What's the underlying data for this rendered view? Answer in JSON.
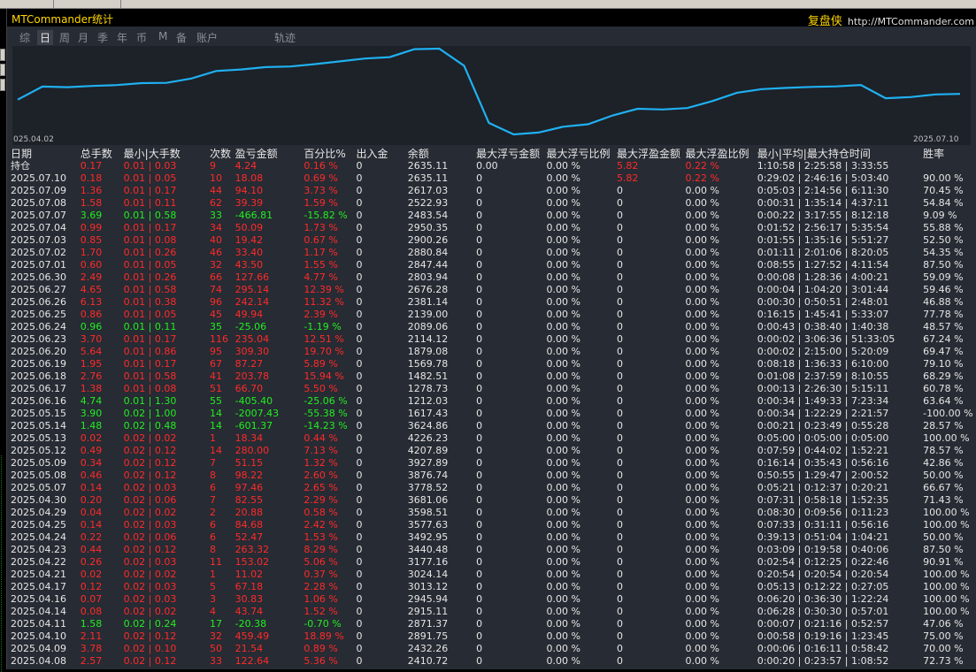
{
  "app": {
    "title": "MTCommander统计",
    "brand_name": "复盘侠",
    "brand_url": "http://MTCommander.com"
  },
  "tabs": [
    {
      "label": "综",
      "active": false
    },
    {
      "label": "日",
      "active": true
    },
    {
      "label": "周",
      "active": false
    },
    {
      "label": "月",
      "active": false
    },
    {
      "label": "季",
      "active": false
    },
    {
      "label": "年",
      "active": false
    },
    {
      "label": "币",
      "active": false
    },
    {
      "label": "M",
      "active": false
    },
    {
      "label": "备",
      "active": false
    },
    {
      "label": "账户",
      "active": false
    },
    {
      "label": "轨迹",
      "active": false
    }
  ],
  "chart_data": {
    "type": "line",
    "start_label": "025.04.02",
    "end_label": "2025.07.10",
    "line_color": "#1fb0f0",
    "series": [
      {
        "values": [
          2432.26,
          2891.75,
          2871.37,
          2915.11,
          2945.94,
          3013.12,
          3024.14,
          3177.16,
          3440.48,
          3492.95,
          3577.63,
          3598.51,
          3681.06,
          3778.52,
          3876.74,
          3927.89,
          4207.89,
          4226.23,
          3624.86,
          1617.43,
          1212.03,
          1278.73,
          1482.51,
          1569.78,
          1879.08,
          2114.12,
          2089.06,
          2139.0,
          2381.14,
          2676.28,
          2803.94,
          2847.44,
          2880.84,
          2900.26,
          2950.35,
          2483.54,
          2522.93,
          2617.03,
          2635.11
        ]
      }
    ]
  },
  "table": {
    "headers": [
      "日期",
      "总手数",
      "最小|大手数",
      "次数",
      "盈亏金额",
      "百分比%",
      "出入金",
      "余额",
      "最大浮亏金额",
      "最大浮亏比例",
      "最大浮盈金额",
      "最大浮盈比例",
      "最小|平均|最大持仓时间",
      "胜率"
    ],
    "rows": [
      {
        "d": "持仓",
        "lots": "0.17",
        "mm": "0.01 | 0.03",
        "cnt": "9",
        "pl": "4.24",
        "pct": "0.16 %",
        "dep": "0",
        "bal": "2635.11",
        "fl": "0.00",
        "flp": "0.00 %",
        "fp": "5.82",
        "fpp": "0.22 %",
        "time": "1:10:58 | 2:25:58 | 3:33:55",
        "win": "",
        "c": "r",
        "fr": true
      },
      {
        "d": "2025.07.10",
        "lots": "0.18",
        "mm": "0.01 | 0.05",
        "cnt": "10",
        "pl": "18.08",
        "pct": "0.69 %",
        "dep": "0",
        "bal": "2635.11",
        "fl": "0",
        "flp": "0.00 %",
        "fp": "5.82",
        "fpp": "0.22 %",
        "time": "0:29:02 | 2:46:16 | 5:03:40",
        "win": "90.00 %",
        "c": "r",
        "fr": true
      },
      {
        "d": "2025.07.09",
        "lots": "1.36",
        "mm": "0.01 | 0.17",
        "cnt": "44",
        "pl": "94.10",
        "pct": "3.73 %",
        "dep": "0",
        "bal": "2617.03",
        "fl": "0",
        "flp": "0.00 %",
        "fp": "0",
        "fpp": "0.00 %",
        "time": "0:05:03 | 2:14:56 | 6:11:30",
        "win": "70.45 %",
        "c": "r"
      },
      {
        "d": "2025.07.08",
        "lots": "1.58",
        "mm": "0.01 | 0.11",
        "cnt": "62",
        "pl": "39.39",
        "pct": "1.59 %",
        "dep": "0",
        "bal": "2522.93",
        "fl": "0",
        "flp": "0.00 %",
        "fp": "0",
        "fpp": "0.00 %",
        "time": "0:00:31 | 1:35:14 | 4:37:11",
        "win": "54.84 %",
        "c": "r"
      },
      {
        "d": "2025.07.07",
        "lots": "3.69",
        "mm": "0.01 | 0.58",
        "cnt": "33",
        "pl": "-466.81",
        "pct": "-15.82 %",
        "dep": "0",
        "bal": "2483.54",
        "fl": "0",
        "flp": "0.00 %",
        "fp": "0",
        "fpp": "0.00 %",
        "time": "0:00:22 | 3:17:55 | 8:12:18",
        "win": "9.09 %",
        "c": "g"
      },
      {
        "d": "2025.07.04",
        "lots": "0.99",
        "mm": "0.01 | 0.17",
        "cnt": "34",
        "pl": "50.09",
        "pct": "1.73 %",
        "dep": "0",
        "bal": "2950.35",
        "fl": "0",
        "flp": "0.00 %",
        "fp": "0",
        "fpp": "0.00 %",
        "time": "0:01:52 | 2:56:17 | 5:35:54",
        "win": "55.88 %",
        "c": "r"
      },
      {
        "d": "2025.07.03",
        "lots": "0.85",
        "mm": "0.01 | 0.08",
        "cnt": "40",
        "pl": "19.42",
        "pct": "0.67 %",
        "dep": "0",
        "bal": "2900.26",
        "fl": "0",
        "flp": "0.00 %",
        "fp": "0",
        "fpp": "0.00 %",
        "time": "0:01:55 | 1:35:16 | 5:51:27",
        "win": "52.50 %",
        "c": "r"
      },
      {
        "d": "2025.07.02",
        "lots": "1.70",
        "mm": "0.01 | 0.26",
        "cnt": "46",
        "pl": "33.40",
        "pct": "1.17 %",
        "dep": "0",
        "bal": "2880.84",
        "fl": "0",
        "flp": "0.00 %",
        "fp": "0",
        "fpp": "0.00 %",
        "time": "0:01:11 | 2:01:06 | 8:20:05",
        "win": "54.35 %",
        "c": "r"
      },
      {
        "d": "2025.07.01",
        "lots": "0.60",
        "mm": "0.01 | 0.05",
        "cnt": "32",
        "pl": "43.50",
        "pct": "1.55 %",
        "dep": "0",
        "bal": "2847.44",
        "fl": "0",
        "flp": "0.00 %",
        "fp": "0",
        "fpp": "0.00 %",
        "time": "0:08:55 | 1:27:52 | 4:11:54",
        "win": "87.50 %",
        "c": "r"
      },
      {
        "d": "2025.06.30",
        "lots": "2.49",
        "mm": "0.01 | 0.26",
        "cnt": "66",
        "pl": "127.66",
        "pct": "4.77 %",
        "dep": "0",
        "bal": "2803.94",
        "fl": "0",
        "flp": "0.00 %",
        "fp": "0",
        "fpp": "0.00 %",
        "time": "0:00:08 | 1:28:36 | 4:00:21",
        "win": "59.09 %",
        "c": "r"
      },
      {
        "d": "2025.06.27",
        "lots": "4.65",
        "mm": "0.01 | 0.58",
        "cnt": "74",
        "pl": "295.14",
        "pct": "12.39 %",
        "dep": "0",
        "bal": "2676.28",
        "fl": "0",
        "flp": "0.00 %",
        "fp": "0",
        "fpp": "0.00 %",
        "time": "0:00:04 | 1:04:20 | 3:01:44",
        "win": "59.46 %",
        "c": "r"
      },
      {
        "d": "2025.06.26",
        "lots": "6.13",
        "mm": "0.01 | 0.38",
        "cnt": "96",
        "pl": "242.14",
        "pct": "11.32 %",
        "dep": "0",
        "bal": "2381.14",
        "fl": "0",
        "flp": "0.00 %",
        "fp": "0",
        "fpp": "0.00 %",
        "time": "0:00:30 | 0:50:51 | 2:48:01",
        "win": "46.88 %",
        "c": "r"
      },
      {
        "d": "2025.06.25",
        "lots": "0.86",
        "mm": "0.01 | 0.05",
        "cnt": "45",
        "pl": "49.94",
        "pct": "2.39 %",
        "dep": "0",
        "bal": "2139.00",
        "fl": "0",
        "flp": "0.00 %",
        "fp": "0",
        "fpp": "0.00 %",
        "time": "0:16:15 | 1:45:41 | 5:33:07",
        "win": "77.78 %",
        "c": "r"
      },
      {
        "d": "2025.06.24",
        "lots": "0.96",
        "mm": "0.01 | 0.11",
        "cnt": "35",
        "pl": "-25.06",
        "pct": "-1.19 %",
        "dep": "0",
        "bal": "2089.06",
        "fl": "0",
        "flp": "0.00 %",
        "fp": "0",
        "fpp": "0.00 %",
        "time": "0:00:43 | 0:38:40 | 1:40:38",
        "win": "48.57 %",
        "c": "g"
      },
      {
        "d": "2025.06.23",
        "lots": "3.70",
        "mm": "0.01 | 0.17",
        "cnt": "116",
        "pl": "235.04",
        "pct": "12.51 %",
        "dep": "0",
        "bal": "2114.12",
        "fl": "0",
        "flp": "0.00 %",
        "fp": "0",
        "fpp": "0.00 %",
        "time": "0:00:02 | 3:06:36 | 51:33:05",
        "win": "67.24 %",
        "c": "r"
      },
      {
        "d": "2025.06.20",
        "lots": "5.64",
        "mm": "0.01 | 0.86",
        "cnt": "95",
        "pl": "309.30",
        "pct": "19.70 %",
        "dep": "0",
        "bal": "1879.08",
        "fl": "0",
        "flp": "0.00 %",
        "fp": "0",
        "fpp": "0.00 %",
        "time": "0:00:02 | 2:15:00 | 5:20:09",
        "win": "69.47 %",
        "c": "r"
      },
      {
        "d": "2025.06.19",
        "lots": "1.95",
        "mm": "0.01 | 0.17",
        "cnt": "67",
        "pl": "87.27",
        "pct": "5.89 %",
        "dep": "0",
        "bal": "1569.78",
        "fl": "0",
        "flp": "0.00 %",
        "fp": "0",
        "fpp": "0.00 %",
        "time": "0:08:18 | 1:36:33 | 6:10:00",
        "win": "79.10 %",
        "c": "r"
      },
      {
        "d": "2025.06.18",
        "lots": "2.76",
        "mm": "0.01 | 0.58",
        "cnt": "41",
        "pl": "203.78",
        "pct": "15.94 %",
        "dep": "0",
        "bal": "1482.51",
        "fl": "0",
        "flp": "0.00 %",
        "fp": "0",
        "fpp": "0.00 %",
        "time": "0:01:08 | 2:37:59 | 8:10:55",
        "win": "68.29 %",
        "c": "r"
      },
      {
        "d": "2025.06.17",
        "lots": "1.38",
        "mm": "0.01 | 0.08",
        "cnt": "51",
        "pl": "66.70",
        "pct": "5.50 %",
        "dep": "0",
        "bal": "1278.73",
        "fl": "0",
        "flp": "0.00 %",
        "fp": "0",
        "fpp": "0.00 %",
        "time": "0:00:13 | 2:26:30 | 5:15:11",
        "win": "60.78 %",
        "c": "r"
      },
      {
        "d": "2025.06.16",
        "lots": "4.74",
        "mm": "0.01 | 1.30",
        "cnt": "55",
        "pl": "-405.40",
        "pct": "-25.06 %",
        "dep": "0",
        "bal": "1212.03",
        "fl": "0",
        "flp": "0.00 %",
        "fp": "0",
        "fpp": "0.00 %",
        "time": "0:00:34 | 1:49:33 | 7:23:34",
        "win": "63.64 %",
        "c": "g"
      },
      {
        "d": "2025.05.15",
        "lots": "3.90",
        "mm": "0.02 | 1.00",
        "cnt": "14",
        "pl": "-2007.43",
        "pct": "-55.38 %",
        "dep": "0",
        "bal": "1617.43",
        "fl": "0",
        "flp": "0.00 %",
        "fp": "0",
        "fpp": "0.00 %",
        "time": "0:00:34 | 1:22:29 | 2:21:57",
        "win": "-100.00 %",
        "c": "g"
      },
      {
        "d": "2025.05.14",
        "lots": "1.48",
        "mm": "0.02 | 0.48",
        "cnt": "14",
        "pl": "-601.37",
        "pct": "-14.23 %",
        "dep": "0",
        "bal": "3624.86",
        "fl": "0",
        "flp": "0.00 %",
        "fp": "0",
        "fpp": "0.00 %",
        "time": "0:00:21 | 0:23:49 | 0:55:28",
        "win": "28.57 %",
        "c": "g"
      },
      {
        "d": "2025.05.13",
        "lots": "0.02",
        "mm": "0.02 | 0.02",
        "cnt": "1",
        "pl": "18.34",
        "pct": "0.44 %",
        "dep": "0",
        "bal": "4226.23",
        "fl": "0",
        "flp": "0.00 %",
        "fp": "0",
        "fpp": "0.00 %",
        "time": "0:05:00 | 0:05:00 | 0:05:00",
        "win": "100.00 %",
        "c": "r"
      },
      {
        "d": "2025.05.12",
        "lots": "0.49",
        "mm": "0.02 | 0.12",
        "cnt": "14",
        "pl": "280.00",
        "pct": "7.13 %",
        "dep": "0",
        "bal": "4207.89",
        "fl": "0",
        "flp": "0.00 %",
        "fp": "0",
        "fpp": "0.00 %",
        "time": "0:07:59 | 0:44:02 | 1:52:21",
        "win": "78.57 %",
        "c": "r"
      },
      {
        "d": "2025.05.09",
        "lots": "0.34",
        "mm": "0.02 | 0.12",
        "cnt": "7",
        "pl": "51.15",
        "pct": "1.32 %",
        "dep": "0",
        "bal": "3927.89",
        "fl": "0",
        "flp": "0.00 %",
        "fp": "0",
        "fpp": "0.00 %",
        "time": "0:16:14 | 0:35:43 | 0:56:16",
        "win": "42.86 %",
        "c": "r"
      },
      {
        "d": "2025.05.08",
        "lots": "0.46",
        "mm": "0.02 | 0.12",
        "cnt": "8",
        "pl": "98.22",
        "pct": "2.60 %",
        "dep": "0",
        "bal": "3876.74",
        "fl": "0",
        "flp": "0.00 %",
        "fp": "0",
        "fpp": "0.00 %",
        "time": "0:50:55 | 1:29:47 | 2:00:52",
        "win": "50.00 %",
        "c": "r"
      },
      {
        "d": "2025.05.07",
        "lots": "0.14",
        "mm": "0.02 | 0.03",
        "cnt": "6",
        "pl": "97.46",
        "pct": "2.65 %",
        "dep": "0",
        "bal": "3778.52",
        "fl": "0",
        "flp": "0.00 %",
        "fp": "0",
        "fpp": "0.00 %",
        "time": "0:05:21 | 0:12:37 | 0:20:21",
        "win": "66.67 %",
        "c": "r"
      },
      {
        "d": "2025.04.30",
        "lots": "0.20",
        "mm": "0.02 | 0.06",
        "cnt": "7",
        "pl": "82.55",
        "pct": "2.29 %",
        "dep": "0",
        "bal": "3681.06",
        "fl": "0",
        "flp": "0.00 %",
        "fp": "0",
        "fpp": "0.00 %",
        "time": "0:07:31 | 0:58:18 | 1:52:35",
        "win": "71.43 %",
        "c": "r"
      },
      {
        "d": "2025.04.29",
        "lots": "0.04",
        "mm": "0.02 | 0.02",
        "cnt": "2",
        "pl": "20.88",
        "pct": "0.58 %",
        "dep": "0",
        "bal": "3598.51",
        "fl": "0",
        "flp": "0.00 %",
        "fp": "0",
        "fpp": "0.00 %",
        "time": "0:08:30 | 0:09:56 | 0:11:23",
        "win": "100.00 %",
        "c": "r"
      },
      {
        "d": "2025.04.25",
        "lots": "0.14",
        "mm": "0.02 | 0.03",
        "cnt": "6",
        "pl": "84.68",
        "pct": "2.42 %",
        "dep": "0",
        "bal": "3577.63",
        "fl": "0",
        "flp": "0.00 %",
        "fp": "0",
        "fpp": "0.00 %",
        "time": "0:07:33 | 0:31:11 | 0:56:16",
        "win": "100.00 %",
        "c": "r"
      },
      {
        "d": "2025.04.24",
        "lots": "0.22",
        "mm": "0.02 | 0.06",
        "cnt": "6",
        "pl": "52.47",
        "pct": "1.53 %",
        "dep": "0",
        "bal": "3492.95",
        "fl": "0",
        "flp": "0.00 %",
        "fp": "0",
        "fpp": "0.00 %",
        "time": "0:39:13 | 0:51:04 | 1:04:21",
        "win": "50.00 %",
        "c": "r"
      },
      {
        "d": "2025.04.23",
        "lots": "0.44",
        "mm": "0.02 | 0.12",
        "cnt": "8",
        "pl": "263.32",
        "pct": "8.29 %",
        "dep": "0",
        "bal": "3440.48",
        "fl": "0",
        "flp": "0.00 %",
        "fp": "0",
        "fpp": "0.00 %",
        "time": "0:03:09 | 0:19:58 | 0:40:06",
        "win": "87.50 %",
        "c": "r"
      },
      {
        "d": "2025.04.22",
        "lots": "0.26",
        "mm": "0.02 | 0.03",
        "cnt": "11",
        "pl": "153.02",
        "pct": "5.06 %",
        "dep": "0",
        "bal": "3177.16",
        "fl": "0",
        "flp": "0.00 %",
        "fp": "0",
        "fpp": "0.00 %",
        "time": "0:02:54 | 0:12:25 | 0:22:46",
        "win": "90.91 %",
        "c": "r"
      },
      {
        "d": "2025.04.21",
        "lots": "0.02",
        "mm": "0.02 | 0.02",
        "cnt": "1",
        "pl": "11.02",
        "pct": "0.37 %",
        "dep": "0",
        "bal": "3024.14",
        "fl": "0",
        "flp": "0.00 %",
        "fp": "0",
        "fpp": "0.00 %",
        "time": "0:20:54 | 0:20:54 | 0:20:54",
        "win": "100.00 %",
        "c": "r"
      },
      {
        "d": "2025.04.17",
        "lots": "0.12",
        "mm": "0.02 | 0.03",
        "cnt": "5",
        "pl": "67.18",
        "pct": "2.28 %",
        "dep": "0",
        "bal": "3013.12",
        "fl": "0",
        "flp": "0.00 %",
        "fp": "0",
        "fpp": "0.00 %",
        "time": "0:05:13 | 0:12:22 | 0:27:05",
        "win": "100.00 %",
        "c": "r"
      },
      {
        "d": "2025.04.16",
        "lots": "0.07",
        "mm": "0.02 | 0.03",
        "cnt": "3",
        "pl": "30.83",
        "pct": "1.06 %",
        "dep": "0",
        "bal": "2945.94",
        "fl": "0",
        "flp": "0.00 %",
        "fp": "0",
        "fpp": "0.00 %",
        "time": "0:06:20 | 0:36:30 | 1:22:24",
        "win": "100.00 %",
        "c": "r"
      },
      {
        "d": "2025.04.14",
        "lots": "0.08",
        "mm": "0.02 | 0.02",
        "cnt": "4",
        "pl": "43.74",
        "pct": "1.52 %",
        "dep": "0",
        "bal": "2915.11",
        "fl": "0",
        "flp": "0.00 %",
        "fp": "0",
        "fpp": "0.00 %",
        "time": "0:06:28 | 0:30:30 | 0:57:01",
        "win": "100.00 %",
        "c": "r"
      },
      {
        "d": "2025.04.11",
        "lots": "1.58",
        "mm": "0.02 | 0.24",
        "cnt": "17",
        "pl": "-20.38",
        "pct": "-0.70 %",
        "dep": "0",
        "bal": "2871.37",
        "fl": "0",
        "flp": "0.00 %",
        "fp": "0",
        "fpp": "0.00 %",
        "time": "0:00:07 | 0:21:16 | 0:52:57",
        "win": "47.06 %",
        "c": "g"
      },
      {
        "d": "2025.04.10",
        "lots": "2.11",
        "mm": "0.02 | 0.12",
        "cnt": "32",
        "pl": "459.49",
        "pct": "18.89 %",
        "dep": "0",
        "bal": "2891.75",
        "fl": "0",
        "flp": "0.00 %",
        "fp": "0",
        "fpp": "0.00 %",
        "time": "0:00:58 | 0:19:16 | 1:23:45",
        "win": "75.00 %",
        "c": "r"
      },
      {
        "d": "2025.04.09",
        "lots": "3.78",
        "mm": "0.02 | 0.10",
        "cnt": "50",
        "pl": "21.54",
        "pct": "0.89 %",
        "dep": "0",
        "bal": "2432.26",
        "fl": "0",
        "flp": "0.00 %",
        "fp": "0",
        "fpp": "0.00 %",
        "time": "0:00:06 | 0:16:11 | 0:58:42",
        "win": "70.00 %",
        "c": "r"
      },
      {
        "d": "2025.04.08",
        "lots": "2.57",
        "mm": "0.02 | 0.12",
        "cnt": "33",
        "pl": "122.64",
        "pct": "5.36 %",
        "dep": "0",
        "bal": "2410.72",
        "fl": "0",
        "flp": "0.00 %",
        "fp": "0",
        "fpp": "0.00 %",
        "time": "0:00:20 | 0:23:57 | 1:08:52",
        "win": "72.73 %",
        "c": "r"
      }
    ]
  }
}
